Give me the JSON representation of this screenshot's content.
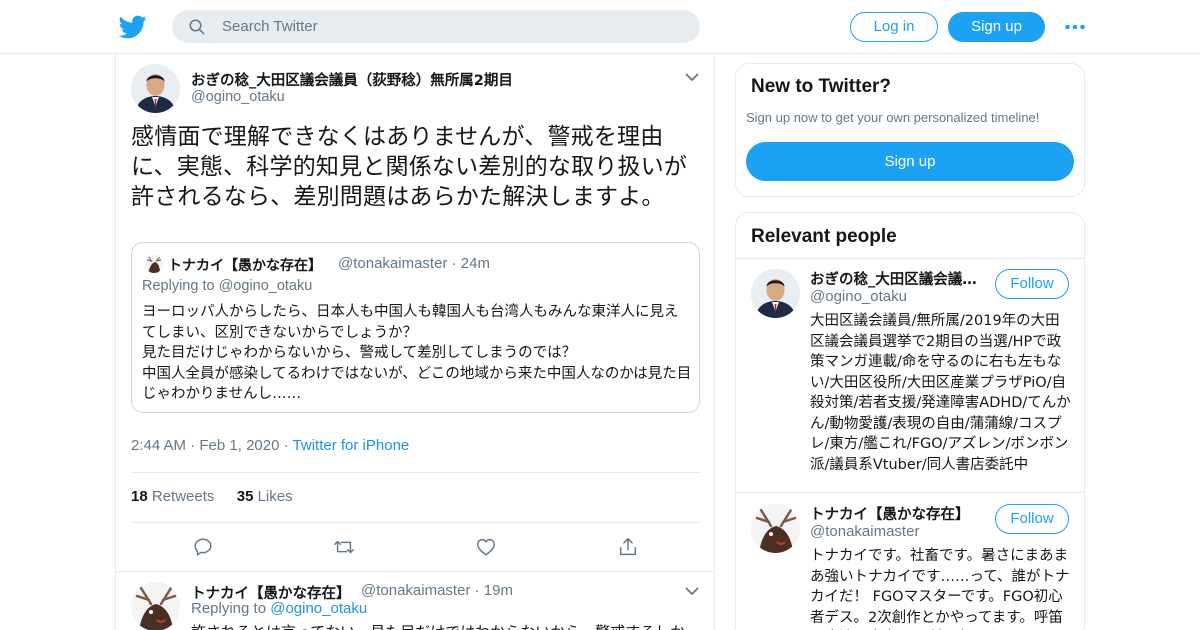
{
  "topbar": {
    "search_placeholder": "Search Twitter",
    "login_label": "Log in",
    "signup_label": "Sign up"
  },
  "tweet": {
    "author_name": "おぎの稔_大田区議会議員（荻野稔）無所属2期目",
    "author_handle": "@ogino_otaku",
    "text": "感情面で理解できなくはありませんが、警戒を理由に、実態、科学的知見と関係ない差別的な取り扱いが許されるなら、差別問題はあらかた解決しますよ。",
    "quoted": {
      "author_name": "トナカイ【愚かな存在】",
      "author_handle": "@tonakaimaster",
      "time": "· 24m",
      "replying_to": "Replying to @ogino_otaku",
      "text": "ヨーロッパ人からしたら、日本人も中国人も韓国人も台湾人もみんな東洋人に見えてしまい、区別できないからでしょうか？\n見た目だけじゃわからないから、警戒して差別してしまうのでは？\n中国人全員が感染してるわけではないが、どこの地域から来た中国人なのかは見た目じゃわかりませんし……"
    },
    "time": "2:44 AM",
    "sep": "·",
    "date": "Feb 1, 2020",
    "via": "Twitter for iPhone",
    "retweets_count": "18",
    "retweets_label": "Retweets",
    "likes_count": "35",
    "likes_label": "Likes"
  },
  "reply": {
    "author_name": "トナカイ【愚かな存在】",
    "author_handle": "@tonakaimaster",
    "time": "· 19m",
    "replying_prefix": "Replying to",
    "replying_handle": "@ogino_otaku",
    "text": "許されるとは言ってない…見た目だけではわからないから、警戒するしか"
  },
  "sidebar": {
    "new_title": "New to Twitter?",
    "new_sub": "Sign up now to get your own personalized timeline!",
    "new_signup": "Sign up",
    "relevant_title": "Relevant people",
    "people": [
      {
        "name": "おぎの稔_大田区議会議員（荻野稔）無所属2期目",
        "handle": "@ogino_otaku",
        "follow": "Follow",
        "bio": "大田区議会議員/無所属/2019年の大田区議会議員選挙で2期目の当選/HPで政策マンガ連載/命を守るのに右も左もない/大田区役所/大田区産業プラザPiO/自殺対策/若者支援/発達障害ADHD/てんかん/動物愛護/表現の自由/蒲蒲線/コスプレ/東方/艦これ/FGO/アズレン/ボンボン派/議員系Vtuber/同人書店委託中"
      },
      {
        "name": "トナカイ【愚かな存在】",
        "handle": "@tonakaimaster",
        "follow": "Follow",
        "bio": "トナカイです。社畜です。暑さにまあまあ強いトナカイです……って、誰がトナカイだ！ FGOマスターです。FGO初心者デス。2次創作とかやってます。呼笛は座渡の食卓！ 異論は認めない"
      }
    ]
  },
  "colors": {
    "accent": "#1da1f2",
    "link": "#1b95e0",
    "secondary_text": "#657786",
    "border": "#e6ecf0"
  },
  "icons": [
    "twitter-bird-icon",
    "search-icon",
    "more-dots-icon",
    "chevron-down-icon",
    "reply-icon",
    "retweet-icon",
    "like-icon",
    "share-icon"
  ]
}
